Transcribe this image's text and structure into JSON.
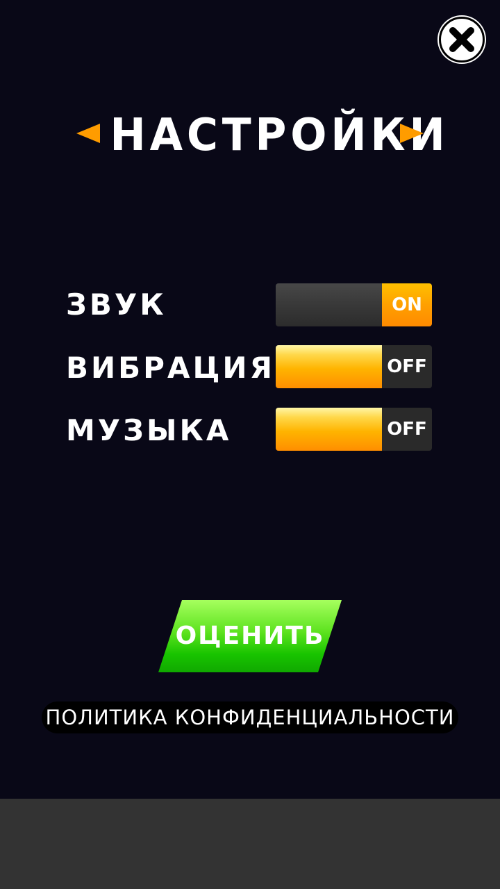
{
  "title": "НАСТРОЙКИ",
  "close_icon": "close-icon",
  "nav_icons": [
    "arrow-left-icon",
    "arrow-right-icon"
  ],
  "settings": [
    {
      "label": "ЗВУК",
      "state": "ON"
    },
    {
      "label": "ВИБРАЦИЯ",
      "state": "OFF"
    },
    {
      "label": "МУЗЫКА",
      "state": "OFF"
    }
  ],
  "rate_button": "ОЦЕНИТЬ",
  "privacy_link": "ПОЛИТИКА КОНФИДЕНЦИАЛЬНОСТИ",
  "colors": {
    "background": "#090817",
    "accent": "#ff9c00",
    "rate_green": "#18c400",
    "bottom_bar": "#333333"
  }
}
